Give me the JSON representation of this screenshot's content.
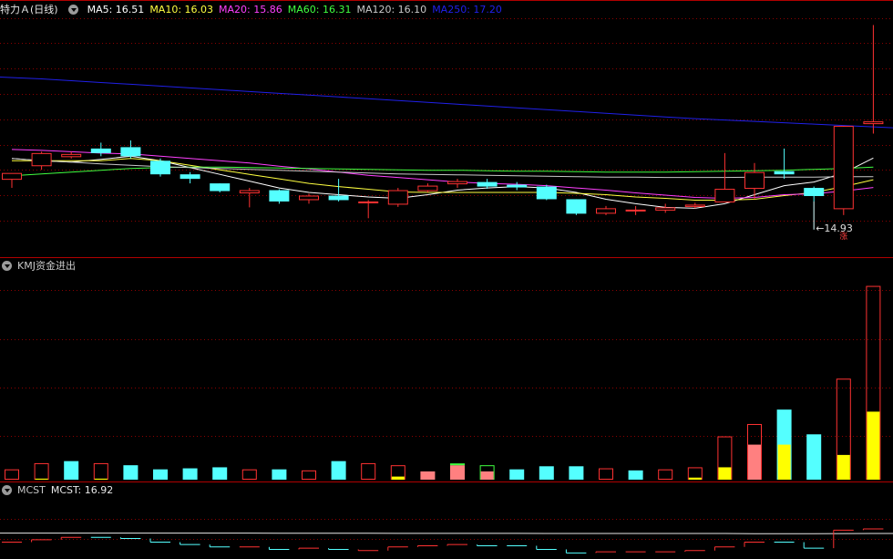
{
  "header_main": {
    "stock_name": "特力Ａ",
    "period": "(日线)",
    "ma": [
      {
        "label": "MA5: 16.51",
        "color": "#ffffff"
      },
      {
        "label": "MA10: 16.03",
        "color": "#ffff40"
      },
      {
        "label": "MA20: 15.86",
        "color": "#ff40ff"
      },
      {
        "label": "MA60: 16.31",
        "color": "#40ff40"
      },
      {
        "label": "MA120: 16.10",
        "color": "#c8c8c8"
      },
      {
        "label": "MA250: 17.20",
        "color": "#2020e8"
      }
    ]
  },
  "header_kmj": {
    "label": "KMJ资金进出"
  },
  "header_mcst": {
    "name": "MCST",
    "value_label": "MCST: 16.92"
  },
  "annotations": {
    "low_price": "14.93",
    "rise_badge": "涨"
  },
  "colors": {
    "up": "#ff3232",
    "down": "#54ffff",
    "grid": "#8b0000",
    "frame": "#b00000",
    "yellow": "#ffff00",
    "pink": "#ff8080"
  },
  "chart_data": [
    {
      "type": "candlestick",
      "name": "price",
      "ylim": [
        14.4,
        19.6
      ],
      "candles": [
        {
          "o": 16.05,
          "h": 16.15,
          "l": 15.85,
          "c": 16.18,
          "dir": "up"
        },
        {
          "o": 16.35,
          "h": 16.65,
          "l": 16.25,
          "c": 16.62,
          "dir": "up"
        },
        {
          "o": 16.55,
          "h": 16.65,
          "l": 16.5,
          "c": 16.6,
          "dir": "up"
        },
        {
          "o": 16.72,
          "h": 16.85,
          "l": 16.55,
          "c": 16.62,
          "dir": "down"
        },
        {
          "o": 16.75,
          "h": 16.9,
          "l": 16.5,
          "c": 16.55,
          "dir": "down"
        },
        {
          "o": 16.45,
          "h": 16.5,
          "l": 16.1,
          "c": 16.15,
          "dir": "down"
        },
        {
          "o": 16.15,
          "h": 16.2,
          "l": 15.95,
          "c": 16.05,
          "dir": "down"
        },
        {
          "o": 15.95,
          "h": 15.95,
          "l": 15.75,
          "c": 15.78,
          "dir": "down"
        },
        {
          "o": 15.75,
          "h": 15.85,
          "l": 15.42,
          "c": 15.8,
          "dir": "up"
        },
        {
          "o": 15.8,
          "h": 15.82,
          "l": 15.5,
          "c": 15.55,
          "dir": "down"
        },
        {
          "o": 15.6,
          "h": 15.72,
          "l": 15.5,
          "c": 15.68,
          "dir": "up"
        },
        {
          "o": 15.68,
          "h": 16.05,
          "l": 15.55,
          "c": 15.58,
          "dir": "down"
        },
        {
          "o": 15.55,
          "h": 15.58,
          "l": 15.18,
          "c": 15.55,
          "dir": "up"
        },
        {
          "o": 15.5,
          "h": 15.85,
          "l": 15.43,
          "c": 15.8,
          "dir": "up"
        },
        {
          "o": 15.8,
          "h": 15.95,
          "l": 15.75,
          "c": 15.9,
          "dir": "up"
        },
        {
          "o": 15.95,
          "h": 16.05,
          "l": 15.85,
          "c": 16.0,
          "dir": "up"
        },
        {
          "o": 15.98,
          "h": 16.05,
          "l": 15.83,
          "c": 15.88,
          "dir": "down"
        },
        {
          "o": 15.92,
          "h": 15.98,
          "l": 15.8,
          "c": 15.86,
          "dir": "down"
        },
        {
          "o": 15.88,
          "h": 15.92,
          "l": 15.58,
          "c": 15.6,
          "dir": "down"
        },
        {
          "o": 15.6,
          "h": 15.6,
          "l": 15.25,
          "c": 15.28,
          "dir": "down"
        },
        {
          "o": 15.3,
          "h": 15.45,
          "l": 15.25,
          "c": 15.4,
          "dir": "up"
        },
        {
          "o": 15.35,
          "h": 15.45,
          "l": 15.25,
          "c": 15.37,
          "dir": "up"
        },
        {
          "o": 15.37,
          "h": 15.5,
          "l": 15.3,
          "c": 15.42,
          "dir": "up"
        },
        {
          "o": 15.45,
          "h": 15.52,
          "l": 15.4,
          "c": 15.48,
          "dir": "up"
        },
        {
          "o": 15.55,
          "h": 16.62,
          "l": 15.55,
          "c": 15.83,
          "dir": "up"
        },
        {
          "o": 15.85,
          "h": 16.4,
          "l": 15.6,
          "c": 16.2,
          "dir": "up"
        },
        {
          "o": 16.22,
          "h": 16.72,
          "l": 16.05,
          "c": 16.15,
          "dir": "down"
        },
        {
          "o": 15.85,
          "h": 15.88,
          "l": 14.93,
          "c": 15.67,
          "dir": "down"
        },
        {
          "o": 15.4,
          "h": 17.22,
          "l": 15.25,
          "c": 17.22,
          "dir": "up"
        },
        {
          "o": 17.28,
          "h": 19.45,
          "l": 17.05,
          "c": 17.32,
          "dir": "up"
        }
      ],
      "ma_series": [
        {
          "name": "MA5",
          "color": "#ffffff",
          "values": [
            16.5,
            16.45,
            16.42,
            16.48,
            16.55,
            16.45,
            16.3,
            16.15,
            16.0,
            15.85,
            15.75,
            15.7,
            15.65,
            15.62,
            15.7,
            15.8,
            15.85,
            15.88,
            15.85,
            15.75,
            15.6,
            15.5,
            15.42,
            15.4,
            15.5,
            15.7,
            15.9,
            15.98,
            16.18,
            16.51
          ]
        },
        {
          "name": "MA10",
          "color": "#ffff40",
          "values": [
            16.45,
            16.45,
            16.45,
            16.45,
            16.5,
            16.45,
            16.35,
            16.25,
            16.15,
            16.05,
            15.95,
            15.88,
            15.82,
            15.76,
            15.75,
            15.75,
            15.75,
            15.75,
            15.75,
            15.73,
            15.7,
            15.65,
            15.62,
            15.58,
            15.58,
            15.6,
            15.68,
            15.75,
            15.88,
            16.03
          ]
        },
        {
          "name": "MA20",
          "color": "#ff40ff",
          "values": [
            16.7,
            16.68,
            16.65,
            16.62,
            16.6,
            16.55,
            16.5,
            16.45,
            16.4,
            16.33,
            16.27,
            16.2,
            16.13,
            16.08,
            16.03,
            15.98,
            15.95,
            15.93,
            15.9,
            15.85,
            15.8,
            15.74,
            15.69,
            15.64,
            15.62,
            15.64,
            15.7,
            15.72,
            15.78,
            15.86
          ]
        },
        {
          "name": "MA60",
          "color": "#40ff40",
          "values": [
            16.12,
            16.16,
            16.2,
            16.24,
            16.28,
            16.3,
            16.31,
            16.31,
            16.3,
            16.29,
            16.28,
            16.27,
            16.26,
            16.25,
            16.24,
            16.24,
            16.23,
            16.22,
            16.22,
            16.21,
            16.2,
            16.2,
            16.2,
            16.21,
            16.22,
            16.23,
            16.24,
            16.26,
            16.28,
            16.31
          ]
        },
        {
          "name": "MA120",
          "color": "#c8c8c8",
          "values": [
            16.5,
            16.45,
            16.42,
            16.38,
            16.35,
            16.32,
            16.3,
            16.28,
            16.26,
            16.24,
            16.22,
            16.2,
            16.18,
            16.16,
            16.15,
            16.14,
            16.13,
            16.12,
            16.11,
            16.1,
            16.09,
            16.09,
            16.08,
            16.08,
            16.08,
            16.09,
            16.09,
            16.09,
            16.1,
            16.1
          ]
        },
        {
          "name": "MA250",
          "color": "#2020e8",
          "values": [
            18.3,
            18.26,
            18.22,
            18.18,
            18.14,
            18.1,
            18.06,
            18.02,
            17.98,
            17.94,
            17.9,
            17.86,
            17.82,
            17.78,
            17.74,
            17.7,
            17.66,
            17.62,
            17.58,
            17.54,
            17.5,
            17.46,
            17.42,
            17.38,
            17.35,
            17.32,
            17.29,
            17.26,
            17.23,
            17.2
          ]
        }
      ]
    },
    {
      "type": "bar",
      "name": "KMJ资金进出",
      "ylim": [
        0,
        100
      ],
      "bars": [
        {
          "v": 5,
          "style": "red-outline",
          "inner": 0
        },
        {
          "v": 8,
          "style": "red-outline",
          "inner": 0.5,
          "inner_color": "yellow"
        },
        {
          "v": 9,
          "style": "cyan",
          "inner": 0
        },
        {
          "v": 8,
          "style": "red-outline",
          "inner": 0.5,
          "inner_color": "yellow"
        },
        {
          "v": 7,
          "style": "cyan",
          "inner": 0
        },
        {
          "v": 5,
          "style": "cyan",
          "inner": 0
        },
        {
          "v": 5.5,
          "style": "cyan",
          "inner": 0
        },
        {
          "v": 6,
          "style": "cyan",
          "inner": 0
        },
        {
          "v": 5,
          "style": "red-outline",
          "inner": 0
        },
        {
          "v": 5,
          "style": "cyan",
          "inner": 0
        },
        {
          "v": 4.5,
          "style": "red-outline",
          "inner": 0
        },
        {
          "v": 9,
          "style": "cyan",
          "inner": 0
        },
        {
          "v": 8,
          "style": "red-outline",
          "inner": 0
        },
        {
          "v": 7,
          "style": "red-outline",
          "inner": 1.5,
          "inner_color": "yellow"
        },
        {
          "v": 4,
          "style": "pink",
          "inner": 0
        },
        {
          "v": 7,
          "style": "pink",
          "inner": 0,
          "cap": "green"
        },
        {
          "v": 7,
          "style": "green-outline",
          "inner": 4,
          "inner_color": "pink"
        },
        {
          "v": 5,
          "style": "cyan",
          "inner": 0
        },
        {
          "v": 6.5,
          "style": "cyan",
          "inner": 0
        },
        {
          "v": 6.5,
          "style": "cyan",
          "inner": 0
        },
        {
          "v": 5.5,
          "style": "red-outline",
          "inner": 0
        },
        {
          "v": 4.5,
          "style": "cyan",
          "inner": 0
        },
        {
          "v": 5,
          "style": "red-outline",
          "inner": 0
        },
        {
          "v": 6,
          "style": "red-outline",
          "inner": 1,
          "inner_color": "yellow"
        },
        {
          "v": 21,
          "style": "red-outline",
          "inner": 6,
          "inner_color": "yellow"
        },
        {
          "v": 27,
          "style": "red-outline",
          "inner": 17,
          "inner_color": "pink"
        },
        {
          "v": 34,
          "style": "cyan",
          "inner": 17,
          "inner_color": "yellow"
        },
        {
          "v": 22,
          "style": "cyan",
          "inner": 0
        },
        {
          "v": 49,
          "style": "red-outline",
          "inner": 12,
          "inner_color": "yellow"
        },
        {
          "v": 94,
          "style": "red-outline",
          "inner": 33,
          "inner_color": "yellow"
        }
      ]
    },
    {
      "type": "line",
      "name": "MCST",
      "ylim": [
        14.8,
        19.8
      ],
      "cost_line": [
        16.95,
        16.95,
        16.95,
        16.95,
        16.95,
        16.95,
        16.95,
        16.95,
        16.95,
        16.94,
        16.94,
        16.94,
        16.94,
        16.93,
        16.93,
        16.93,
        16.93,
        16.93,
        16.92,
        16.92,
        16.92,
        16.92,
        16.92,
        16.92,
        16.92,
        16.9,
        16.9,
        16.9,
        16.91,
        16.92
      ],
      "step_price": [
        16.2,
        16.4,
        16.6,
        16.6,
        16.5,
        16.2,
        16.0,
        15.8,
        15.8,
        15.6,
        15.7,
        15.6,
        15.5,
        15.8,
        15.9,
        16.0,
        15.9,
        15.9,
        15.6,
        15.3,
        15.4,
        15.4,
        15.4,
        15.5,
        15.8,
        16.2,
        16.2,
        15.7,
        17.2,
        17.3
      ],
      "step_dir": [
        "up",
        "up",
        "up",
        "down",
        "down",
        "down",
        "down",
        "down",
        "up",
        "down",
        "up",
        "down",
        "up",
        "up",
        "up",
        "up",
        "down",
        "down",
        "down",
        "down",
        "up",
        "up",
        "up",
        "up",
        "up",
        "up",
        "down",
        "down",
        "up",
        "up"
      ]
    }
  ]
}
